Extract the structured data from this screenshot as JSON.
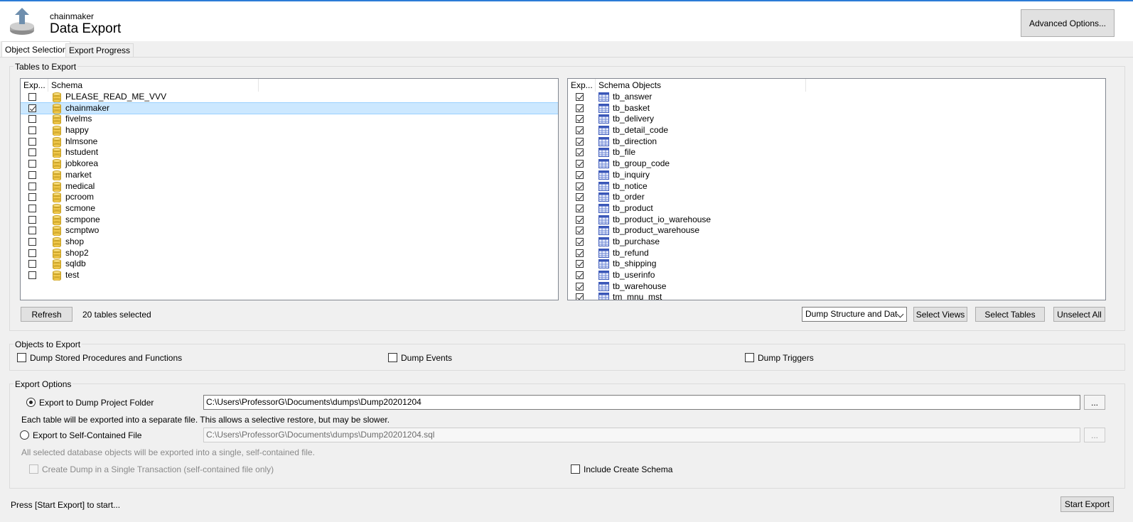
{
  "header": {
    "subtitle": "chainmaker",
    "title": "Data Export",
    "advanced_button": "Advanced Options...",
    "icon": "export-upload-icon"
  },
  "tabs": [
    "Object Selection",
    "Export Progress"
  ],
  "tables_to_export": {
    "group_label": "Tables to Export",
    "schema_list": {
      "col_export": "Exp...",
      "col_schema": "Schema",
      "rows": [
        {
          "name": "PLEASE_READ_ME_VVV",
          "checked": false,
          "selected": false
        },
        {
          "name": "chainmaker",
          "checked": true,
          "selected": true
        },
        {
          "name": "fivelms",
          "checked": false,
          "selected": false
        },
        {
          "name": "happy",
          "checked": false,
          "selected": false
        },
        {
          "name": "hlmsone",
          "checked": false,
          "selected": false
        },
        {
          "name": "hstudent",
          "checked": false,
          "selected": false
        },
        {
          "name": "jobkorea",
          "checked": false,
          "selected": false
        },
        {
          "name": "market",
          "checked": false,
          "selected": false
        },
        {
          "name": "medical",
          "checked": false,
          "selected": false
        },
        {
          "name": "pcroom",
          "checked": false,
          "selected": false
        },
        {
          "name": "scmone",
          "checked": false,
          "selected": false
        },
        {
          "name": "scmpone",
          "checked": false,
          "selected": false
        },
        {
          "name": "scmptwo",
          "checked": false,
          "selected": false
        },
        {
          "name": "shop",
          "checked": false,
          "selected": false
        },
        {
          "name": "shop2",
          "checked": false,
          "selected": false
        },
        {
          "name": "sqldb",
          "checked": false,
          "selected": false
        },
        {
          "name": "test",
          "checked": false,
          "selected": false
        }
      ]
    },
    "objects_list": {
      "col_export": "Exp...",
      "col_objects": "Schema Objects",
      "rows": [
        {
          "name": "tb_answer",
          "checked": true
        },
        {
          "name": "tb_basket",
          "checked": true
        },
        {
          "name": "tb_delivery",
          "checked": true
        },
        {
          "name": "tb_detail_code",
          "checked": true
        },
        {
          "name": "tb_direction",
          "checked": true
        },
        {
          "name": "tb_file",
          "checked": true
        },
        {
          "name": "tb_group_code",
          "checked": true
        },
        {
          "name": "tb_inquiry",
          "checked": true
        },
        {
          "name": "tb_notice",
          "checked": true
        },
        {
          "name": "tb_order",
          "checked": true
        },
        {
          "name": "tb_product",
          "checked": true
        },
        {
          "name": "tb_product_io_warehouse",
          "checked": true
        },
        {
          "name": "tb_product_warehouse",
          "checked": true
        },
        {
          "name": "tb_purchase",
          "checked": true
        },
        {
          "name": "tb_refund",
          "checked": true
        },
        {
          "name": "tb_shipping",
          "checked": true
        },
        {
          "name": "tb_userinfo",
          "checked": true
        },
        {
          "name": "tb_warehouse",
          "checked": true
        },
        {
          "name": "tm_mnu_mst",
          "checked": true
        }
      ]
    },
    "refresh_button": "Refresh",
    "selected_count": "20 tables selected",
    "dump_select": "Dump Structure and Dat",
    "select_views_button": "Select Views",
    "select_tables_button": "Select Tables",
    "unselect_all_button": "Unselect All"
  },
  "objects_to_export": {
    "group_label": "Objects to Export",
    "stored_procs": "Dump Stored Procedures and Functions",
    "events": "Dump Events",
    "triggers": "Dump Triggers"
  },
  "export_options": {
    "group_label": "Export Options",
    "folder_radio": "Export to Dump Project Folder",
    "folder_path": "C:\\Users\\ProfessorG\\Documents\\dumps\\Dump20201204",
    "folder_note": "Each table will be exported into a separate file. This allows a selective restore, but may be slower.",
    "file_radio": "Export to Self-Contained File",
    "file_path": "C:\\Users\\ProfessorG\\Documents\\dumps\\Dump20201204.sql",
    "file_note": "All selected database objects will be exported into a single, self-contained file.",
    "single_transaction": "Create Dump in a Single Transaction (self-contained file only)",
    "include_schema": "Include Create Schema",
    "browse_label": "..."
  },
  "footer": {
    "status": "Press [Start Export] to start...",
    "start_button": "Start Export"
  }
}
